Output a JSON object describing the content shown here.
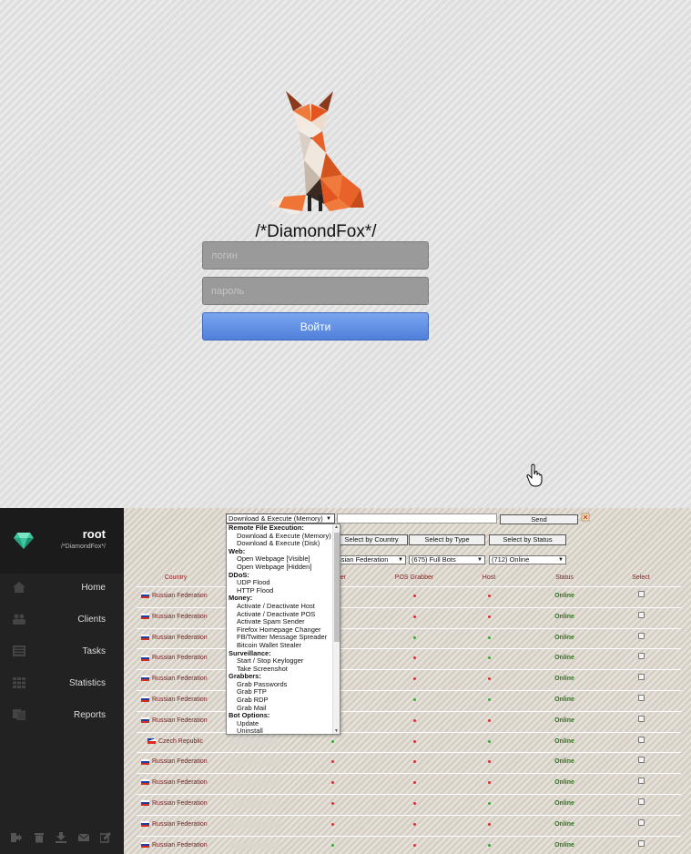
{
  "login": {
    "brand_title": "/*DiamondFox*/",
    "login_placeholder": "логин",
    "password_placeholder": "пароль",
    "submit_label": "Войти"
  },
  "sidebar": {
    "user_name": "root",
    "user_subtitle": "/*DiamondFox*/",
    "items": [
      {
        "label": "Home",
        "icon": "home-icon"
      },
      {
        "label": "Clients",
        "icon": "users-icon"
      },
      {
        "label": "Tasks",
        "icon": "tasks-icon"
      },
      {
        "label": "Statistics",
        "icon": "grid-icon"
      },
      {
        "label": "Reports",
        "icon": "reports-icon"
      }
    ],
    "bottom_icons": [
      "logout-icon",
      "trash-icon",
      "download-icon",
      "mail-icon",
      "edit-icon"
    ]
  },
  "toolbar": {
    "command_value": "Download & Execute (Memory)",
    "send_label": "Send",
    "select_country_label": "Select by Country",
    "select_type_label": "Select by Type",
    "select_status_label": "Select by Status",
    "filter_country_value": "ssian Federation",
    "filter_bots_value": "(675) Full Bots",
    "filter_status_value": "(712) Online"
  },
  "command_menu": {
    "items": [
      {
        "type": "group",
        "label": "Remote File Execution:"
      },
      {
        "type": "option",
        "label": "Download & Execute (Memory)"
      },
      {
        "type": "option",
        "label": "Download & Execute (Disk)"
      },
      {
        "type": "group",
        "label": "Web:"
      },
      {
        "type": "option",
        "label": "Open Webpage [Visible]"
      },
      {
        "type": "option",
        "label": "Open Webpage [Hidden]"
      },
      {
        "type": "group",
        "label": "DDoS:"
      },
      {
        "type": "option",
        "label": "UDP Flood"
      },
      {
        "type": "option",
        "label": "HTTP Flood"
      },
      {
        "type": "group",
        "label": "Money:"
      },
      {
        "type": "option",
        "label": "Activate / Deactivate Host"
      },
      {
        "type": "option",
        "label": "Activate / Deactivate POS"
      },
      {
        "type": "option",
        "label": "Activate Spam Sender"
      },
      {
        "type": "option",
        "label": "Firefox Homepage Changer"
      },
      {
        "type": "option",
        "label": "FB/Twitter Message Spreader"
      },
      {
        "type": "option",
        "label": "Bitcoin Wallet Stealer"
      },
      {
        "type": "group",
        "label": "Surveillance:"
      },
      {
        "type": "option",
        "label": "Start / Stop Keylogger"
      },
      {
        "type": "option",
        "label": "Take Screenshot"
      },
      {
        "type": "group",
        "label": "Grabbers:"
      },
      {
        "type": "option",
        "label": "Grab Passwords"
      },
      {
        "type": "option",
        "label": "Grab FTP"
      },
      {
        "type": "option",
        "label": "Grab RDP"
      },
      {
        "type": "option",
        "label": "Grab Mail"
      },
      {
        "type": "group",
        "label": "Bot Options:"
      },
      {
        "type": "option",
        "label": "Update"
      },
      {
        "type": "option",
        "label": "Uninstall"
      }
    ]
  },
  "table": {
    "headers": {
      "country": "Country",
      "stealer": "er",
      "pos": "POS Grabber",
      "host": "Host",
      "status": "Status",
      "select": "Select"
    },
    "rows": [
      {
        "country": "Russian Federation",
        "flag": "ru",
        "stealer": "red",
        "pos": "red",
        "host": "red",
        "status": "Online"
      },
      {
        "country": "Russian Federation",
        "flag": "ru",
        "stealer": "red",
        "pos": "red",
        "host": "red",
        "status": "Online"
      },
      {
        "country": "Russian Federation",
        "flag": "ru",
        "stealer": "red",
        "pos": "green",
        "host": "green",
        "status": "Online"
      },
      {
        "country": "Russian Federation",
        "flag": "ru",
        "stealer": "red",
        "pos": "red",
        "host": "green",
        "status": "Online"
      },
      {
        "country": "Russian Federation",
        "flag": "ru",
        "stealer": "red",
        "pos": "red",
        "host": "red",
        "status": "Online"
      },
      {
        "country": "Russian Federation",
        "flag": "ru",
        "stealer": "red",
        "pos": "green",
        "host": "green",
        "status": "Online"
      },
      {
        "country": "Russian Federation",
        "flag": "ru",
        "stealer": "red",
        "pos": "red",
        "host": "red",
        "status": "Online"
      },
      {
        "country": "Czech Republic",
        "flag": "cz",
        "stealer": "green",
        "pos": "red",
        "host": "green",
        "status": "Online"
      },
      {
        "country": "Russian Federation",
        "flag": "ru",
        "stealer": "red",
        "pos": "red",
        "host": "red",
        "status": "Online"
      },
      {
        "country": "Russian Federation",
        "flag": "ru",
        "stealer": "red",
        "pos": "red",
        "host": "red",
        "status": "Online"
      },
      {
        "country": "Russian Federation",
        "flag": "ru",
        "stealer": "red",
        "pos": "red",
        "host": "green",
        "status": "Online"
      },
      {
        "country": "Russian Federation",
        "flag": "ru",
        "stealer": "red",
        "pos": "red",
        "host": "red",
        "status": "Online"
      },
      {
        "country": "Russian Federation",
        "flag": "ru",
        "stealer": "green",
        "pos": "red",
        "host": "green",
        "status": "Online"
      }
    ]
  },
  "colors": {
    "login_button": "#5a86dc",
    "sidebar_bg": "#222222",
    "status_online": "#2a7a1a",
    "header_text": "#8b1c1c",
    "gem": "#3cc7a0",
    "fox_orange": "#e8622a"
  }
}
